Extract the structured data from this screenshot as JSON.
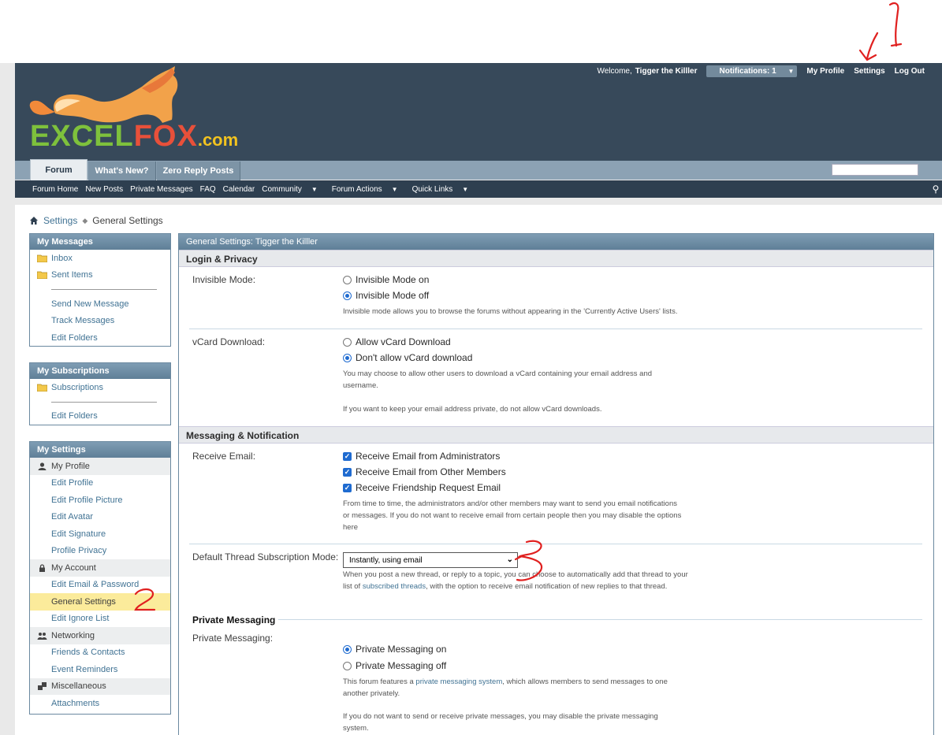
{
  "header": {
    "welcome_prefix": "Welcome,",
    "username": "Tigger the Killler",
    "notifications": "Notifications: 1",
    "my_profile": "My Profile",
    "settings": "Settings",
    "log_out": "Log Out",
    "logo": {
      "part1": "EXCEL",
      "part2": "FOX",
      "part3": ".com"
    }
  },
  "nav": {
    "tabs": [
      "Forum",
      "What's New?",
      "Zero Reply Posts"
    ],
    "subnav": [
      "Forum Home",
      "New Posts",
      "Private Messages",
      "FAQ",
      "Calendar",
      "Community",
      "Forum Actions",
      "Quick Links"
    ]
  },
  "breadcrumb": {
    "parent": "Settings",
    "current": "General Settings"
  },
  "sidebar": {
    "messages": {
      "title": "My Messages",
      "folders": [
        "Inbox",
        "Sent Items"
      ],
      "links": [
        "Send New Message",
        "Track Messages",
        "Edit Folders"
      ]
    },
    "subscriptions": {
      "title": "My Subscriptions",
      "folders": [
        "Subscriptions"
      ],
      "links": [
        "Edit Folders"
      ]
    },
    "settings": {
      "title": "My Settings",
      "profile_cat": "My Profile",
      "profile_links": [
        "Edit Profile",
        "Edit Profile Picture",
        "Edit Avatar",
        "Edit Signature",
        "Profile Privacy"
      ],
      "account_cat": "My Account",
      "account_links": [
        "Edit Email & Password",
        "General Settings",
        "Edit Ignore List"
      ],
      "networking_cat": "Networking",
      "networking_links": [
        "Friends & Contacts",
        "Event Reminders"
      ],
      "misc_cat": "Miscellaneous",
      "misc_links": [
        "Attachments"
      ]
    }
  },
  "main": {
    "title": "General Settings: Tigger the Killler",
    "login_privacy": {
      "heading": "Login & Privacy",
      "invisible_label": "Invisible Mode:",
      "invisible_on": "Invisible Mode on",
      "invisible_off": "Invisible Mode off",
      "invisible_desc": "Invisible mode allows you to browse the forums without appearing in the 'Currently Active Users' lists.",
      "vcard_label": "vCard Download:",
      "vcard_allow": "Allow vCard Download",
      "vcard_deny": "Don't allow vCard download",
      "vcard_desc1": "You may choose to allow other users to download a vCard containing your email address and username.",
      "vcard_desc2": "If you want to keep your email address private, do not allow vCard downloads."
    },
    "messaging": {
      "heading": "Messaging & Notification",
      "receive_label": "Receive Email:",
      "receive_admin": "Receive Email from Administrators",
      "receive_members": "Receive Email from Other Members",
      "receive_friend": "Receive Friendship Request Email",
      "receive_desc": "From time to time, the administrators and/or other members may want to send you email notifications or messages. If you do not want to receive email from certain people then you may disable the options here",
      "thread_label": "Default Thread Subscription Mode:",
      "thread_value": "Instantly, using email",
      "thread_desc_a": "When you post a new thread, or reply to a topic, you can choose to automatically add that thread to your list of ",
      "thread_desc_link": "subscribed threads",
      "thread_desc_b": ", with the option to receive email notification of new replies to that thread."
    },
    "pm": {
      "heading": "Private Messaging",
      "label": "Private Messaging:",
      "on": "Private Messaging on",
      "off": "Private Messaging off",
      "desc_a": "This forum features a ",
      "desc_link": "private messaging system",
      "desc_b": ", which allows members to send messages to one another privately.",
      "desc2": "If you do not want to send or receive private messages, you may disable the private messaging system."
    }
  },
  "annotations": {
    "color": "#e0201f",
    "labels": [
      "1",
      "2",
      "3"
    ]
  },
  "colors": {
    "header": "#37495a",
    "navbar": "#8ca2b4",
    "accent_link": "#417394",
    "active_item": "#fbeb9b",
    "radio_on": "#1f6bd0"
  }
}
